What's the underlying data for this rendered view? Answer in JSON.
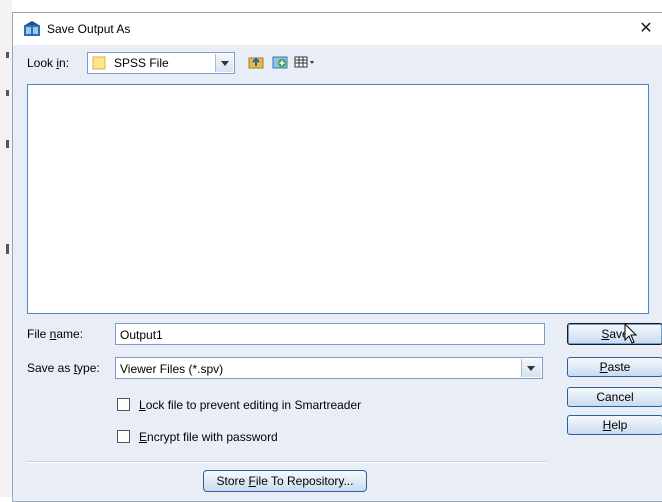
{
  "window": {
    "title": "Save Output As",
    "close_glyph": "✕"
  },
  "look_in": {
    "label_pre": "Look ",
    "label_key": "i",
    "label_post": "n:",
    "value": "SPSS File"
  },
  "toolbar": {
    "icons": [
      "up-folder-icon",
      "new-folder-icon",
      "view-menu-icon"
    ]
  },
  "file_name": {
    "label_pre": "File ",
    "label_key": "n",
    "label_post": "ame:",
    "value": "Output1"
  },
  "save_as_type": {
    "label_pre": "Save as ",
    "label_key": "t",
    "label_post": "ype:",
    "value": "Viewer Files (*.spv)"
  },
  "options": {
    "lock": {
      "key": "L",
      "rest": "ock file to prevent editing in Smartreader",
      "checked": false
    },
    "encrypt": {
      "key": "E",
      "rest": "ncrypt file with password",
      "checked": false
    }
  },
  "buttons": {
    "save": {
      "key": "S",
      "rest": "ave"
    },
    "paste": {
      "key": "P",
      "rest": "aste"
    },
    "cancel": {
      "label": "Cancel"
    },
    "help": {
      "key": "H",
      "rest": "elp"
    },
    "store": {
      "pre": "Store ",
      "key": "F",
      "post": "ile To Repository..."
    }
  },
  "colors": {
    "accent_border": "#4a89c8",
    "dialog_bg": "#e9eef6"
  }
}
